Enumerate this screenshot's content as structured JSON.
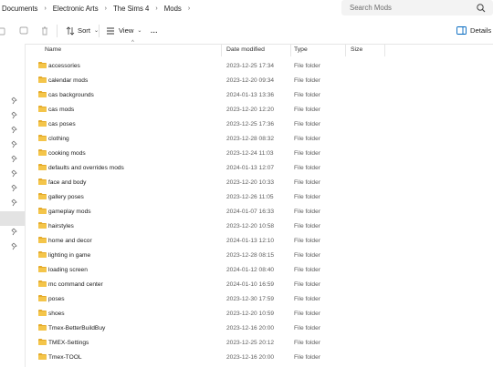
{
  "breadcrumbs": [
    "Documents",
    "Electronic Arts",
    "The Sims 4",
    "Mods"
  ],
  "search": {
    "placeholder": "Search Mods",
    "icon": "search-icon"
  },
  "toolbar": {
    "sort_label": "Sort",
    "view_label": "View",
    "more_label": "...",
    "details_label": "Details"
  },
  "columns": {
    "name": "Name",
    "date": "Date modified",
    "type": "Type",
    "size": "Size"
  },
  "files": [
    {
      "name": "accessories",
      "date": "2023-12-25 17:34",
      "type": "File folder"
    },
    {
      "name": "calendar mods",
      "date": "2023-12-20 09:34",
      "type": "File folder"
    },
    {
      "name": "cas backgrounds",
      "date": "2024-01-13 13:36",
      "type": "File folder"
    },
    {
      "name": "cas mods",
      "date": "2023-12-20 12:20",
      "type": "File folder"
    },
    {
      "name": "cas poses",
      "date": "2023-12-25 17:36",
      "type": "File folder"
    },
    {
      "name": "clothing",
      "date": "2023-12-28 08:32",
      "type": "File folder"
    },
    {
      "name": "cooking mods",
      "date": "2023-12-24 11:03",
      "type": "File folder"
    },
    {
      "name": "defaults and overrides mods",
      "date": "2024-01-13 12:07",
      "type": "File folder"
    },
    {
      "name": "face and body",
      "date": "2023-12-20 10:33",
      "type": "File folder"
    },
    {
      "name": "gallery poses",
      "date": "2023-12-26 11:05",
      "type": "File folder"
    },
    {
      "name": "gameplay mods",
      "date": "2024-01-07 16:33",
      "type": "File folder"
    },
    {
      "name": "hairstyles",
      "date": "2023-12-20 10:58",
      "type": "File folder"
    },
    {
      "name": "home and decor",
      "date": "2024-01-13 12:10",
      "type": "File folder"
    },
    {
      "name": "lighting in game",
      "date": "2023-12-28 08:15",
      "type": "File folder"
    },
    {
      "name": "loading screen",
      "date": "2024-01-12 08:40",
      "type": "File folder"
    },
    {
      "name": "mc command center",
      "date": "2024-01-10 16:59",
      "type": "File folder"
    },
    {
      "name": "poses",
      "date": "2023-12-30 17:59",
      "type": "File folder"
    },
    {
      "name": "shoes",
      "date": "2023-12-20 10:59",
      "type": "File folder"
    },
    {
      "name": "Tmex-BetterBuildBuy",
      "date": "2023-12-16 20:00",
      "type": "File folder"
    },
    {
      "name": "TMEX-Settings",
      "date": "2023-12-25 20:12",
      "type": "File folder"
    },
    {
      "name": "Tmex-TOOL",
      "date": "2023-12-16 20:00",
      "type": "File folder"
    }
  ],
  "colors": {
    "folder": "#f4c54a",
    "folder_dark": "#e4aa2a",
    "accent": "#0067c0"
  }
}
